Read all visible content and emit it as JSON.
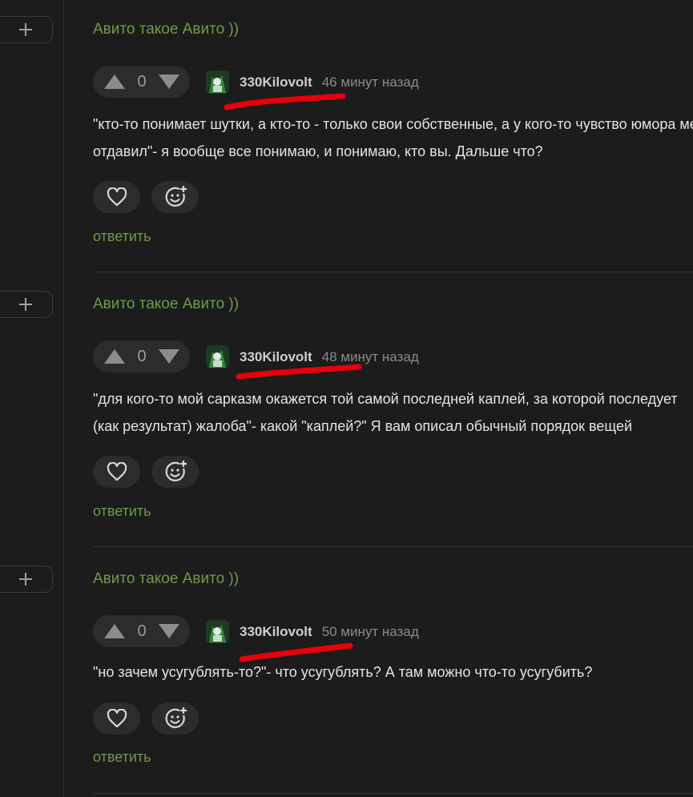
{
  "thread_title": "Авито такое Авито ))",
  "reply_label": "ответить",
  "comments": [
    {
      "vote_count": "0",
      "username": "330Kilovolt",
      "timestamp": "46 минут назад",
      "lines": [
        "\"кто-то понимает шутки, а кто-то - только свои собственные, а у кого-то чувство юмора медведь",
        "отдавил\"- я вообще все понимаю, и понимаю, кто вы. Дальше что?"
      ]
    },
    {
      "vote_count": "0",
      "username": "330Kilovolt",
      "timestamp": "48 минут назад",
      "lines": [
        "\"для кого-то мой сарказм окажется той самой последней каплей, за которой последует",
        "(как результат) жалоба\"- какой \"каплей?\" Я вам описал обычный порядок вещей"
      ]
    },
    {
      "vote_count": "0",
      "username": "330Kilovolt",
      "timestamp": "50 минут назад",
      "lines": [
        "\"но зачем усугублять-то?\"- что усугублять? А там можно что-то усугубить?"
      ]
    }
  ],
  "colors": {
    "background": "#1c1c1c",
    "accent_green": "#6e9b49",
    "button_bg": "#2c2c2c",
    "annotation_red": "#e8000b"
  },
  "icons": [
    "plus-icon",
    "arrow-up-icon",
    "arrow-down-icon",
    "heart-icon",
    "emoji-add-icon"
  ]
}
